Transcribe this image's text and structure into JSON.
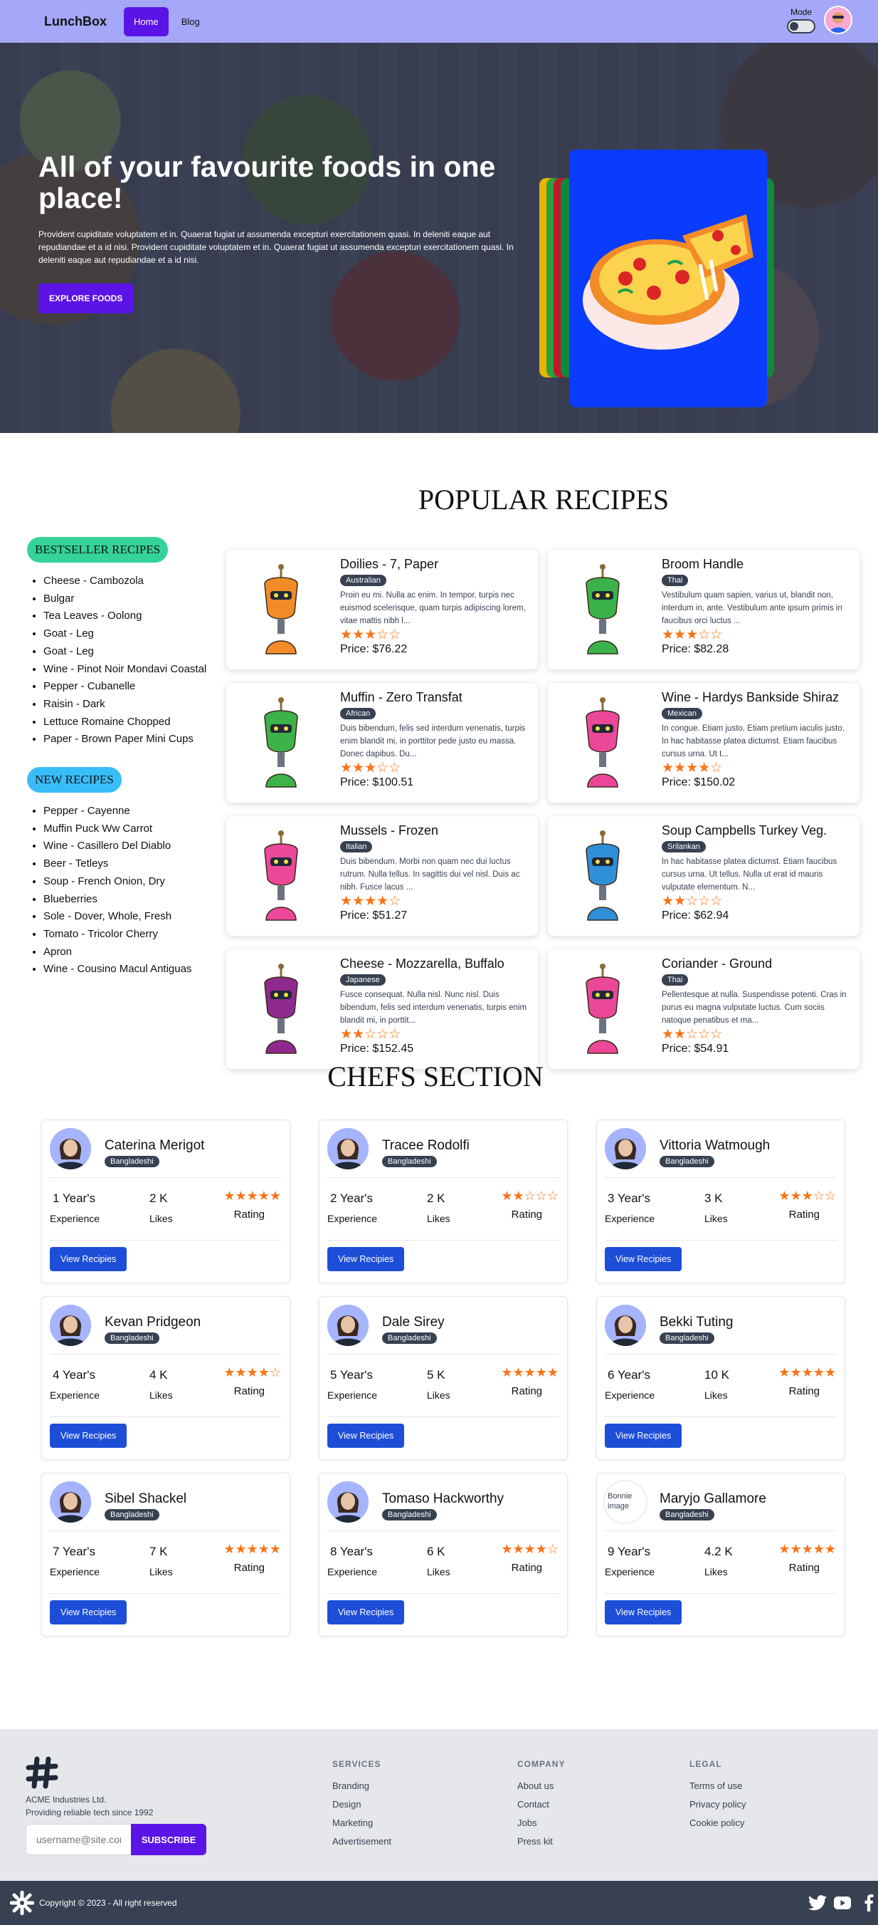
{
  "nav": {
    "brand": "LunchBox",
    "home_label": "Home",
    "blog_label": "Blog",
    "mode_label": "Mode"
  },
  "hero": {
    "title": "All of your favourite foods in one place!",
    "description": "Provident cupiditate voluptatem et in. Quaerat fugiat ut assumenda excepturi exercitationem quasi. In deleniti eaque aut repudiandae et a id nisi. Provident cupiditate voluptatem et in. Quaerat fugiat ut assumenda excepturi exercitationem quasi. In deleniti eaque aut repudiandae et a id nisi.",
    "button_label": "EXPLORE FOODS"
  },
  "recipes": {
    "section_title": "POPULAR RECIPES",
    "bestseller_title": "BESTSELLER RECIPES",
    "bestseller_items": [
      "Cheese - Cambozola",
      "Bulgar",
      "Tea Leaves - Oolong",
      "Goat - Leg",
      "Goat - Leg",
      "Wine - Pinot Noir Mondavi Coastal",
      "Pepper - Cubanelle",
      "Raisin - Dark",
      "Lettuce Romaine Chopped",
      "Paper - Brown Paper Mini Cups"
    ],
    "new_title": "NEW RECIPES",
    "new_items": [
      "Pepper - Cayenne",
      "Muffin Puck Ww Carrot",
      "Wine - Casillero Del Diablo",
      "Beer - Tetleys",
      "Soup - French Onion, Dry",
      "Blueberries",
      "Sole - Dover, Whole, Fresh",
      "Tomato - Tricolor Cherry",
      "Apron",
      "Wine - Cousino Macul Antiguas"
    ],
    "cards": [
      {
        "name": "Doilies - 7, Paper",
        "cuisine": "Australian",
        "desc": "Proin eu mi. Nulla ac enim. In tempor, turpis nec euismod scelerisque, quam turpis adipiscing lorem, vitae mattis nibh l...",
        "stars": "★★★☆☆",
        "rating": 2.5,
        "price": "Price: $76.22",
        "robot_color": "#f28c28"
      },
      {
        "name": "Broom Handle",
        "cuisine": "Thai",
        "desc": "Vestibulum quam sapien, varius ut, blandit non, interdum in, ante. Vestibulum ante ipsum primis in faucibus orci luctus ...",
        "stars": "★★★☆☆",
        "rating": 3.5,
        "price": "Price: $82.28",
        "robot_color": "#3cb34a"
      },
      {
        "name": "Muffin - Zero Transfat",
        "cuisine": "African",
        "desc": "Duis bibendum, felis sed interdum venenatis, turpis enim blandit mi, in porttitor pede justo eu massa. Donec dapibus. Du...",
        "stars": "★★★☆☆",
        "rating": 3.5,
        "price": "Price: $100.51",
        "robot_color": "#3cb34a"
      },
      {
        "name": "Wine - Hardys Bankside Shiraz",
        "cuisine": "Mexican",
        "desc": "In congue. Etiam justo. Etiam pretium iaculis justo. In hac habitasse platea dictumst. Etiam faucibus cursus urna. Ut t...",
        "stars": "★★★★☆",
        "rating": 4.5,
        "price": "Price: $150.02",
        "robot_color": "#ec4899"
      },
      {
        "name": "Mussels - Frozen",
        "cuisine": "Italian",
        "desc": "Duis bibendum. Morbi non quam nec dui luctus rutrum. Nulla tellus. In sagittis dui vel nisl. Duis ac nibh. Fusce lacus ...",
        "stars": "★★★★☆",
        "rating": 4.5,
        "price": "Price: $51.27",
        "robot_color": "#ec4899"
      },
      {
        "name": "Soup Campbells Turkey Veg.",
        "cuisine": "Srilankan",
        "desc": "In hac habitasse platea dictumst. Etiam faucibus cursus urna. Ut tellus. Nulla ut erat id mauris vulputate elementum. N...",
        "stars": "★★☆☆☆",
        "rating": 2.5,
        "price": "Price: $62.94",
        "robot_color": "#2f8fd8"
      },
      {
        "name": "Cheese - Mozzarella, Buffalo",
        "cuisine": "Japanese",
        "desc": "Fusce consequat. Nulla nisl. Nunc nisl. Duis bibendum, felis sed interdum venenatis, turpis enim blandit mi, in porttit...",
        "stars": "★★☆☆☆",
        "rating": 2.5,
        "price": "Price: $152.45",
        "robot_color": "#8e2a8e"
      },
      {
        "name": "Coriander - Ground",
        "cuisine": "Thai",
        "desc": "Pellentesque at nulla. Suspendisse potenti. Cras in purus eu magna vulputate luctus. Cum sociis natoque penatibus et ma...",
        "stars": "★★☆☆☆",
        "rating": 2.5,
        "price": "Price: $54.91",
        "robot_color": "#ec4899"
      }
    ]
  },
  "chefs": {
    "section_title": "CHEFS SECTION",
    "experience_label": "Experience",
    "likes_label": "Likes",
    "rating_label": "Rating",
    "button_label": "View Recipies",
    "items": [
      {
        "name": "Caterina Merigot",
        "origin": "Bangladeshi",
        "experience": "1 Year's",
        "likes": "2 K",
        "stars": "★★★★★",
        "rating": 4.5
      },
      {
        "name": "Tracee Rodolfi",
        "origin": "Bangladeshi",
        "experience": "2 Year's",
        "likes": "2 K",
        "stars": "★★☆☆☆",
        "rating": 2
      },
      {
        "name": "Vittoria Watmough",
        "origin": "Bangladeshi",
        "experience": "3 Year's",
        "likes": "3 K",
        "stars": "★★★☆☆",
        "rating": 3
      },
      {
        "name": "Kevan Pridgeon",
        "origin": "Bangladeshi",
        "experience": "4 Year's",
        "likes": "4 K",
        "stars": "★★★★☆",
        "rating": 4
      },
      {
        "name": "Dale Sirey",
        "origin": "Bangladeshi",
        "experience": "5 Year's",
        "likes": "5 K",
        "stars": "★★★★★",
        "rating": 5
      },
      {
        "name": "Bekki Tuting",
        "origin": "Bangladeshi",
        "experience": "6 Year's",
        "likes": "10 K",
        "stars": "★★★★★",
        "rating": 5
      },
      {
        "name": "Sibel Shackel",
        "origin": "Bangladeshi",
        "experience": "7 Year's",
        "likes": "7 K",
        "stars": "★★★★★",
        "rating": 4.5
      },
      {
        "name": "Tomaso Hackworthy",
        "origin": "Bangladeshi",
        "experience": "8 Year's",
        "likes": "6 K",
        "stars": "★★★★☆",
        "rating": 4
      },
      {
        "name": "Maryjo Gallamore",
        "origin": "Bangladeshi",
        "experience": "9 Year's",
        "likes": "4.2 K",
        "stars": "★★★★★",
        "rating": 5,
        "broken_image_alt": "Bonnie image"
      }
    ]
  },
  "footer": {
    "company_name": "ACME Industries Ltd.",
    "tagline": "Providing reliable tech since 1992",
    "email_placeholder": "username@site.com",
    "subscribe_label": "SUBSCRIBE",
    "services_title": "SERVICES",
    "services": [
      "Branding",
      "Design",
      "Marketing",
      "Advertisement"
    ],
    "company_title": "COMPANY",
    "company_links": [
      "About us",
      "Contact",
      "Jobs",
      "Press kit"
    ],
    "legal_title": "LEGAL",
    "legal_links": [
      "Terms of use",
      "Privacy policy",
      "Cookie policy"
    ],
    "copyright": "Copyright © 2023 - All right reserved"
  },
  "colors": {
    "nav_bg": "#a5a8f8",
    "primary": "#5b14e6",
    "bestseller_pill": "#34d399",
    "new_pill": "#38bdf8",
    "star": "#f97316",
    "chef_button": "#1d4ed8",
    "footer_bg": "#e5e7eb",
    "bottom_bar": "#374151"
  }
}
